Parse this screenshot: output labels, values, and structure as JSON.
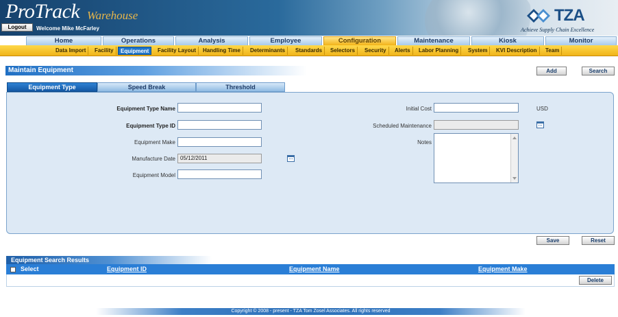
{
  "header": {
    "logo_main": "ProTrack",
    "logo_sub": "Warehouse",
    "logout_label": "Logout",
    "welcome": "Welcome Mike McFarley",
    "tza_logo": "TZA",
    "tagline": "Achieve Supply Chain Excellence"
  },
  "main_nav": [
    "Home",
    "Operations",
    "Analysis",
    "Employee",
    "Configuration",
    "Maintenance",
    "Kiosk",
    "Monitor"
  ],
  "main_nav_active": "Configuration",
  "sub_nav": [
    "Data Import",
    "Facility",
    "Equipment",
    "Facility Layout",
    "Handling Time",
    "Determinants",
    "Standards",
    "Selectors",
    "Security",
    "Alerts",
    "Labor Planning",
    "System",
    "KVI Description",
    "Team"
  ],
  "sub_nav_active": "Equipment",
  "page": {
    "title": "Maintain Equipment",
    "add_label": "Add",
    "search_label": "Search"
  },
  "form_tabs": [
    "Equipment Type",
    "Speed Break",
    "Threshold"
  ],
  "form": {
    "equipment_type_name_label": "Equipment Type Name",
    "equipment_type_name_value": "",
    "equipment_type_id_label": "Equipment Type ID",
    "equipment_type_id_value": "",
    "equipment_make_label": "Equipment Make",
    "equipment_make_value": "",
    "manufacture_date_label": "Manufacture Date",
    "manufacture_date_value": "05/12/2011",
    "equipment_model_label": "Equipment Model",
    "equipment_model_value": "",
    "initial_cost_label": "Initial Cost",
    "initial_cost_value": "",
    "currency": "USD",
    "scheduled_maintenance_label": "Scheduled Maintenance",
    "scheduled_maintenance_value": "",
    "notes_label": "Notes",
    "notes_value": ""
  },
  "actions": {
    "save_label": "Save",
    "reset_label": "Reset",
    "delete_label": "Delete"
  },
  "results": {
    "title": "Equipment Search Results",
    "columns": {
      "select": "Select",
      "equipment_id": "Equipment ID",
      "equipment_name": "Equipment Name",
      "equipment_make": "Equipment Make"
    }
  },
  "footer": "Copyright © 2008 - present - TZA Tom Zosel Associates. All rights reserved",
  "colors": {
    "header_blue": "#16426d",
    "active_tab_gold": "#f2b318",
    "accent_blue": "#2a7ed6",
    "panel_bg": "#dde9f5"
  }
}
